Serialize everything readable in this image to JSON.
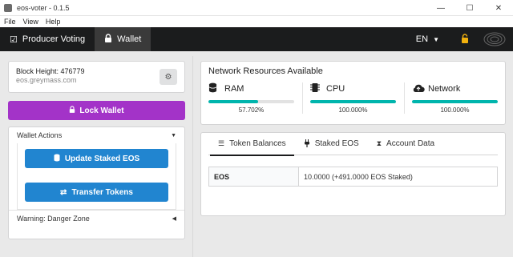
{
  "window": {
    "title": "eos-voter - 0.1.5",
    "controls": [
      "—",
      "☐",
      "✕"
    ]
  },
  "menu": [
    "File",
    "View",
    "Help"
  ],
  "nav": {
    "items": [
      {
        "label": "Producer Voting",
        "icon": "checkbox-icon",
        "active": false
      },
      {
        "label": "Wallet",
        "icon": "lock-icon",
        "active": true
      }
    ],
    "language": "EN"
  },
  "block": {
    "label": "Block Height: 476779",
    "node": "eos.greymass.com"
  },
  "lock_wallet_label": "Lock Wallet",
  "wallet_actions": {
    "title": "Wallet Actions",
    "update_staked_label": "Update Staked EOS",
    "transfer_label": "Transfer Tokens",
    "danger_zone_title": "Warning: Danger Zone"
  },
  "resources": {
    "title": "Network Resources Available",
    "items": [
      {
        "name": "RAM",
        "icon": "database-icon",
        "percent_text": "57.702%",
        "percent": 57.702
      },
      {
        "name": "CPU",
        "icon": "microchip-icon",
        "percent_text": "100.000%",
        "percent": 100
      },
      {
        "name": "Network",
        "icon": "cloud-upload-icon",
        "percent_text": "100.000%",
        "percent": 100
      }
    ],
    "bar_color": "#00b5ad"
  },
  "tabs": [
    {
      "label": "Token Balances",
      "icon": "list-icon",
      "active": true
    },
    {
      "label": "Staked EOS",
      "icon": "plug-icon",
      "active": false
    },
    {
      "label": "Account Data",
      "icon": "hourglass-icon",
      "active": false
    }
  ],
  "balances": [
    {
      "token": "EOS",
      "value": "10.0000 (+491.0000 EOS Staked)"
    }
  ],
  "colors": {
    "lock_button": "#a333c8",
    "action_button": "#2185d0",
    "navbar": "#1b1c1d",
    "lock_nav_icon": "#f2b10e"
  }
}
